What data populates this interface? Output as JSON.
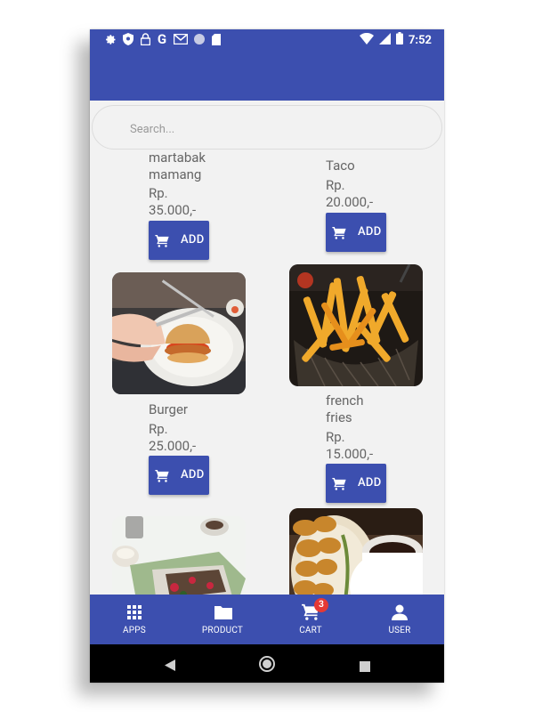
{
  "status_bar": {
    "time": "7:52",
    "left_icons": [
      "gear-icon",
      "shield-icon",
      "lock-icon",
      "google-icon",
      "gmail-icon",
      "circle-icon",
      "sdcard-icon"
    ],
    "right_icons": [
      "wifi-icon",
      "signal-icon",
      "battery-icon"
    ]
  },
  "search": {
    "placeholder": "Search...",
    "value": ""
  },
  "products": [
    {
      "name": "martabak\nmamang",
      "price": "Rp.\n35.000,-",
      "button_label": "ADD",
      "image": "none"
    },
    {
      "name": "Taco",
      "price": "Rp.\n20.000,-",
      "button_label": "ADD",
      "image": "none"
    },
    {
      "name": "Burger",
      "price": "Rp.\n25.000,-",
      "button_label": "ADD",
      "image": "burger-photo"
    },
    {
      "name": "french\nfries",
      "price": "Rp.\n15.000,-",
      "button_label": "ADD",
      "image": "french-fries-photo"
    },
    {
      "image": "waffle-photo"
    },
    {
      "image": "nuggets-coffee-photo"
    }
  ],
  "bottom_nav": {
    "items": [
      {
        "label": "APPS",
        "icon": "grid-icon"
      },
      {
        "label": "PRODUCT",
        "icon": "folder-icon"
      },
      {
        "label": "CART",
        "icon": "cart-icon",
        "badge": "3"
      },
      {
        "label": "USER",
        "icon": "person-icon"
      }
    ]
  },
  "system_nav": {
    "icons": [
      "back-icon",
      "home-icon",
      "recents-icon"
    ]
  },
  "colors": {
    "primary": "#3c4faf",
    "badge": "#e53935",
    "background": "#f2f2f2"
  }
}
